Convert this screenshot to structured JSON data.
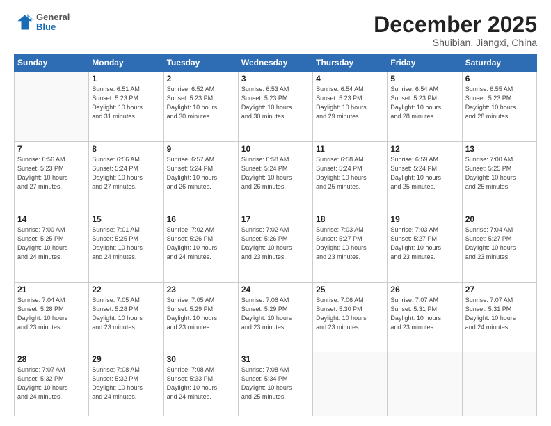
{
  "logo": {
    "general": "General",
    "blue": "Blue"
  },
  "header": {
    "month": "December 2025",
    "location": "Shuibian, Jiangxi, China"
  },
  "days_of_week": [
    "Sunday",
    "Monday",
    "Tuesday",
    "Wednesday",
    "Thursday",
    "Friday",
    "Saturday"
  ],
  "weeks": [
    [
      {
        "day": "",
        "info": ""
      },
      {
        "day": "1",
        "info": "Sunrise: 6:51 AM\nSunset: 5:23 PM\nDaylight: 10 hours\nand 31 minutes."
      },
      {
        "day": "2",
        "info": "Sunrise: 6:52 AM\nSunset: 5:23 PM\nDaylight: 10 hours\nand 30 minutes."
      },
      {
        "day": "3",
        "info": "Sunrise: 6:53 AM\nSunset: 5:23 PM\nDaylight: 10 hours\nand 30 minutes."
      },
      {
        "day": "4",
        "info": "Sunrise: 6:54 AM\nSunset: 5:23 PM\nDaylight: 10 hours\nand 29 minutes."
      },
      {
        "day": "5",
        "info": "Sunrise: 6:54 AM\nSunset: 5:23 PM\nDaylight: 10 hours\nand 28 minutes."
      },
      {
        "day": "6",
        "info": "Sunrise: 6:55 AM\nSunset: 5:23 PM\nDaylight: 10 hours\nand 28 minutes."
      }
    ],
    [
      {
        "day": "7",
        "info": "Sunrise: 6:56 AM\nSunset: 5:23 PM\nDaylight: 10 hours\nand 27 minutes."
      },
      {
        "day": "8",
        "info": "Sunrise: 6:56 AM\nSunset: 5:24 PM\nDaylight: 10 hours\nand 27 minutes."
      },
      {
        "day": "9",
        "info": "Sunrise: 6:57 AM\nSunset: 5:24 PM\nDaylight: 10 hours\nand 26 minutes."
      },
      {
        "day": "10",
        "info": "Sunrise: 6:58 AM\nSunset: 5:24 PM\nDaylight: 10 hours\nand 26 minutes."
      },
      {
        "day": "11",
        "info": "Sunrise: 6:58 AM\nSunset: 5:24 PM\nDaylight: 10 hours\nand 25 minutes."
      },
      {
        "day": "12",
        "info": "Sunrise: 6:59 AM\nSunset: 5:24 PM\nDaylight: 10 hours\nand 25 minutes."
      },
      {
        "day": "13",
        "info": "Sunrise: 7:00 AM\nSunset: 5:25 PM\nDaylight: 10 hours\nand 25 minutes."
      }
    ],
    [
      {
        "day": "14",
        "info": "Sunrise: 7:00 AM\nSunset: 5:25 PM\nDaylight: 10 hours\nand 24 minutes."
      },
      {
        "day": "15",
        "info": "Sunrise: 7:01 AM\nSunset: 5:25 PM\nDaylight: 10 hours\nand 24 minutes."
      },
      {
        "day": "16",
        "info": "Sunrise: 7:02 AM\nSunset: 5:26 PM\nDaylight: 10 hours\nand 24 minutes."
      },
      {
        "day": "17",
        "info": "Sunrise: 7:02 AM\nSunset: 5:26 PM\nDaylight: 10 hours\nand 23 minutes."
      },
      {
        "day": "18",
        "info": "Sunrise: 7:03 AM\nSunset: 5:27 PM\nDaylight: 10 hours\nand 23 minutes."
      },
      {
        "day": "19",
        "info": "Sunrise: 7:03 AM\nSunset: 5:27 PM\nDaylight: 10 hours\nand 23 minutes."
      },
      {
        "day": "20",
        "info": "Sunrise: 7:04 AM\nSunset: 5:27 PM\nDaylight: 10 hours\nand 23 minutes."
      }
    ],
    [
      {
        "day": "21",
        "info": "Sunrise: 7:04 AM\nSunset: 5:28 PM\nDaylight: 10 hours\nand 23 minutes."
      },
      {
        "day": "22",
        "info": "Sunrise: 7:05 AM\nSunset: 5:28 PM\nDaylight: 10 hours\nand 23 minutes."
      },
      {
        "day": "23",
        "info": "Sunrise: 7:05 AM\nSunset: 5:29 PM\nDaylight: 10 hours\nand 23 minutes."
      },
      {
        "day": "24",
        "info": "Sunrise: 7:06 AM\nSunset: 5:29 PM\nDaylight: 10 hours\nand 23 minutes."
      },
      {
        "day": "25",
        "info": "Sunrise: 7:06 AM\nSunset: 5:30 PM\nDaylight: 10 hours\nand 23 minutes."
      },
      {
        "day": "26",
        "info": "Sunrise: 7:07 AM\nSunset: 5:31 PM\nDaylight: 10 hours\nand 23 minutes."
      },
      {
        "day": "27",
        "info": "Sunrise: 7:07 AM\nSunset: 5:31 PM\nDaylight: 10 hours\nand 24 minutes."
      }
    ],
    [
      {
        "day": "28",
        "info": "Sunrise: 7:07 AM\nSunset: 5:32 PM\nDaylight: 10 hours\nand 24 minutes."
      },
      {
        "day": "29",
        "info": "Sunrise: 7:08 AM\nSunset: 5:32 PM\nDaylight: 10 hours\nand 24 minutes."
      },
      {
        "day": "30",
        "info": "Sunrise: 7:08 AM\nSunset: 5:33 PM\nDaylight: 10 hours\nand 24 minutes."
      },
      {
        "day": "31",
        "info": "Sunrise: 7:08 AM\nSunset: 5:34 PM\nDaylight: 10 hours\nand 25 minutes."
      },
      {
        "day": "",
        "info": ""
      },
      {
        "day": "",
        "info": ""
      },
      {
        "day": "",
        "info": ""
      }
    ]
  ]
}
